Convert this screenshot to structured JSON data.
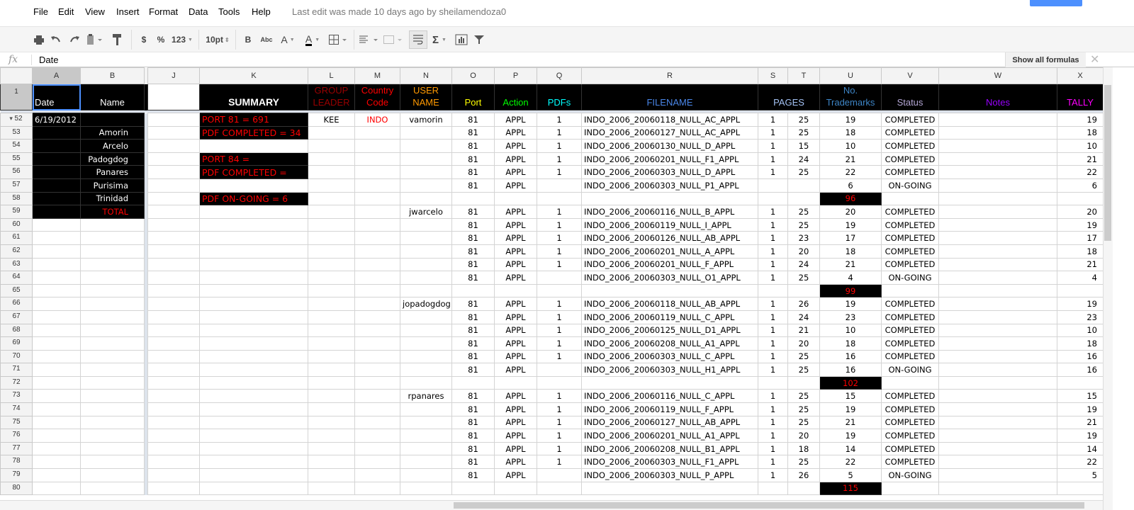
{
  "menu": [
    "File",
    "Edit",
    "View",
    "Insert",
    "Format",
    "Data",
    "Tools",
    "Help"
  ],
  "last_edit": "Last edit was made 10 days ago by sheilamendoza0",
  "toolbar": {
    "currency": "$",
    "percent": "%",
    "number_format": "123",
    "font_size": "10pt",
    "bold": "B",
    "strikethrough": "Abc",
    "text_color": "A",
    "fill_color": "A",
    "sum": "Σ"
  },
  "formula_bar": {
    "fx": "fx",
    "value": "Date",
    "show_all_formulas": "Show all formulas",
    "close": "✕"
  },
  "colors": {
    "group_leader": "#990000",
    "country_code": "#ff0000",
    "user_name": "#ff9900",
    "port": "#ffff00",
    "action": "#00ff00",
    "pdfs": "#00ffff",
    "filename": "#4a86e8",
    "pages": "#a4c2f4",
    "trademarks": "#3d85c6",
    "status": "#b4a7d6",
    "notes": "#9900ff",
    "tally": "#ff00ff",
    "selection": "#4d90fe"
  },
  "columns": [
    "A",
    "B",
    "J",
    "K",
    "L",
    "M",
    "N",
    "O",
    "P",
    "Q",
    "R",
    "S",
    "T",
    "U",
    "V",
    "W",
    "X"
  ],
  "header_row": {
    "row": "1",
    "date": "Date",
    "name": "Name",
    "summary": "SUMMARY",
    "group_leader": "GROUP LEADER",
    "country_code": "Country Code",
    "user_name": "USER NAME",
    "port": "Port",
    "action": "Action",
    "pdfs": "PDFs",
    "filename": "FILENAME",
    "pages": "PAGES",
    "trademarks": "No. Trademarks",
    "status": "Status",
    "notes": "Notes",
    "tally": "TALLY"
  },
  "rows": [
    [
      "52",
      "6/19/2012",
      "",
      "",
      "PORT 81 = 691",
      "KEE",
      "INDO",
      "vamorin",
      "81",
      "APPL",
      "1",
      "INDO_2006_20060118_NULL_AC_APPL",
      "1",
      "25",
      "19",
      "COMPLETED",
      "",
      "19"
    ],
    [
      "53",
      "",
      "Amorin",
      "",
      "PDF COMPLETED = 34",
      "",
      "",
      "",
      "81",
      "APPL",
      "1",
      "INDO_2006_20060127_NULL_AC_APPL",
      "1",
      "25",
      "18",
      "COMPLETED",
      "",
      "18"
    ],
    [
      "54",
      "",
      "Arcelo",
      "",
      "",
      "",
      "",
      "",
      "81",
      "APPL",
      "1",
      "INDO_2006_20060130_NULL_D_APPL",
      "1",
      "15",
      "10",
      "COMPLETED",
      "",
      "10"
    ],
    [
      "55",
      "",
      "Padogdog",
      "",
      "PORT 84 =",
      "",
      "",
      "",
      "81",
      "APPL",
      "1",
      "INDO_2006_20060201_NULL_F1_APPL",
      "1",
      "24",
      "21",
      "COMPLETED",
      "",
      "21"
    ],
    [
      "56",
      "",
      "Panares",
      "",
      "PDF COMPLETED =",
      "",
      "",
      "",
      "81",
      "APPL",
      "1",
      "INDO_2006_20060303_NULL_D_APPL",
      "1",
      "25",
      "22",
      "COMPLETED",
      "",
      "22"
    ],
    [
      "57",
      "",
      "Purisima",
      "",
      "",
      "",
      "",
      "",
      "81",
      "APPL",
      "",
      "INDO_2006_20060303_NULL_P1_APPL",
      "",
      "",
      "6",
      "ON-GOING",
      "",
      "6"
    ],
    [
      "58",
      "",
      "Trinidad",
      "",
      "PDF ON-GOING = 6",
      "",
      "",
      "",
      "",
      "",
      "",
      "",
      "",
      "",
      "96",
      "",
      "",
      ""
    ],
    [
      "59",
      "",
      "TOTAL",
      "",
      "",
      "",
      "",
      "jwarcelo",
      "81",
      "APPL",
      "1",
      "INDO_2006_20060116_NULL_B_APPL",
      "1",
      "25",
      "20",
      "COMPLETED",
      "",
      "20"
    ],
    [
      "60",
      "",
      "",
      "",
      "",
      "",
      "",
      "",
      "81",
      "APPL",
      "1",
      "INDO_2006_20060119_NULL_I_APPL",
      "1",
      "25",
      "19",
      "COMPLETED",
      "",
      "19"
    ],
    [
      "61",
      "",
      "",
      "",
      "",
      "",
      "",
      "",
      "81",
      "APPL",
      "1",
      "INDO_2006_20060126_NULL_AB_APPL",
      "1",
      "23",
      "17",
      "COMPLETED",
      "",
      "17"
    ],
    [
      "62",
      "",
      "",
      "",
      "",
      "",
      "",
      "",
      "81",
      "APPL",
      "1",
      "INDO_2006_20060201_NULL_A_APPL",
      "1",
      "20",
      "18",
      "COMPLETED",
      "",
      "18"
    ],
    [
      "63",
      "",
      "",
      "",
      "",
      "",
      "",
      "",
      "81",
      "APPL",
      "1",
      "INDO_2006_20060201_NULL_F_APPL",
      "1",
      "24",
      "21",
      "COMPLETED",
      "",
      "21"
    ],
    [
      "64",
      "",
      "",
      "",
      "",
      "",
      "",
      "",
      "81",
      "APPL",
      "",
      "INDO_2006_20060303_NULL_O1_APPL",
      "1",
      "25",
      "4",
      "ON-GOING",
      "",
      "4"
    ],
    [
      "65",
      "",
      "",
      "",
      "",
      "",
      "",
      "",
      "",
      "",
      "",
      "",
      "",
      "",
      "99",
      "",
      "",
      ""
    ],
    [
      "66",
      "",
      "",
      "",
      "",
      "",
      "",
      "jopadogdog",
      "81",
      "APPL",
      "1",
      "INDO_2006_20060118_NULL_AB_APPL",
      "1",
      "26",
      "19",
      "COMPLETED",
      "",
      "19"
    ],
    [
      "67",
      "",
      "",
      "",
      "",
      "",
      "",
      "",
      "81",
      "APPL",
      "1",
      "INDO_2006_20060119_NULL_C_APPL",
      "1",
      "24",
      "23",
      "COMPLETED",
      "",
      "23"
    ],
    [
      "68",
      "",
      "",
      "",
      "",
      "",
      "",
      "",
      "81",
      "APPL",
      "1",
      "INDO_2006_20060125_NULL_D1_APPL",
      "1",
      "21",
      "10",
      "COMPLETED",
      "",
      "10"
    ],
    [
      "69",
      "",
      "",
      "",
      "",
      "",
      "",
      "",
      "81",
      "APPL",
      "1",
      "INDO_2006_20060208_NULL_A1_APPL",
      "1",
      "20",
      "18",
      "COMPLETED",
      "",
      "18"
    ],
    [
      "70",
      "",
      "",
      "",
      "",
      "",
      "",
      "",
      "81",
      "APPL",
      "1",
      "INDO_2006_20060303_NULL_C_APPL",
      "1",
      "25",
      "16",
      "COMPLETED",
      "",
      "16"
    ],
    [
      "71",
      "",
      "",
      "",
      "",
      "",
      "",
      "",
      "81",
      "APPL",
      "",
      "INDO_2006_20060303_NULL_H1_APPL",
      "1",
      "25",
      "16",
      "ON-GOING",
      "",
      "16"
    ],
    [
      "72",
      "",
      "",
      "",
      "",
      "",
      "",
      "",
      "",
      "",
      "",
      "",
      "",
      "",
      "102",
      "",
      "",
      ""
    ],
    [
      "73",
      "",
      "",
      "",
      "",
      "",
      "",
      "rpanares",
      "81",
      "APPL",
      "1",
      "INDO_2006_20060116_NULL_C_APPL",
      "1",
      "25",
      "15",
      "COMPLETED",
      "",
      "15"
    ],
    [
      "74",
      "",
      "",
      "",
      "",
      "",
      "",
      "",
      "81",
      "APPL",
      "1",
      "INDO_2006_20060119_NULL_F_APPL",
      "1",
      "25",
      "19",
      "COMPLETED",
      "",
      "19"
    ],
    [
      "75",
      "",
      "",
      "",
      "",
      "",
      "",
      "",
      "81",
      "APPL",
      "1",
      "INDO_2006_20060127_NULL_AB_APPL",
      "1",
      "25",
      "21",
      "COMPLETED",
      "",
      "21"
    ],
    [
      "76",
      "",
      "",
      "",
      "",
      "",
      "",
      "",
      "81",
      "APPL",
      "1",
      "INDO_2006_20060201_NULL_A1_APPL",
      "1",
      "20",
      "19",
      "COMPLETED",
      "",
      "19"
    ],
    [
      "77",
      "",
      "",
      "",
      "",
      "",
      "",
      "",
      "81",
      "APPL",
      "1",
      "INDO_2006_20060208_NULL_B1_APPL",
      "1",
      "18",
      "14",
      "COMPLETED",
      "",
      "14"
    ],
    [
      "78",
      "",
      "",
      "",
      "",
      "",
      "",
      "",
      "81",
      "APPL",
      "1",
      "INDO_2006_20060303_NULL_F1_APPL",
      "1",
      "25",
      "22",
      "COMPLETED",
      "",
      "22"
    ],
    [
      "79",
      "",
      "",
      "",
      "",
      "",
      "",
      "",
      "81",
      "APPL",
      "",
      "INDO_2006_20060303_NULL_P_APPL",
      "1",
      "26",
      "5",
      "ON-GOING",
      "",
      "5"
    ],
    [
      "80",
      "",
      "",
      "",
      "",
      "",
      "",
      "",
      "",
      "",
      "",
      "",
      "",
      "",
      "115",
      "",
      "",
      ""
    ]
  ]
}
